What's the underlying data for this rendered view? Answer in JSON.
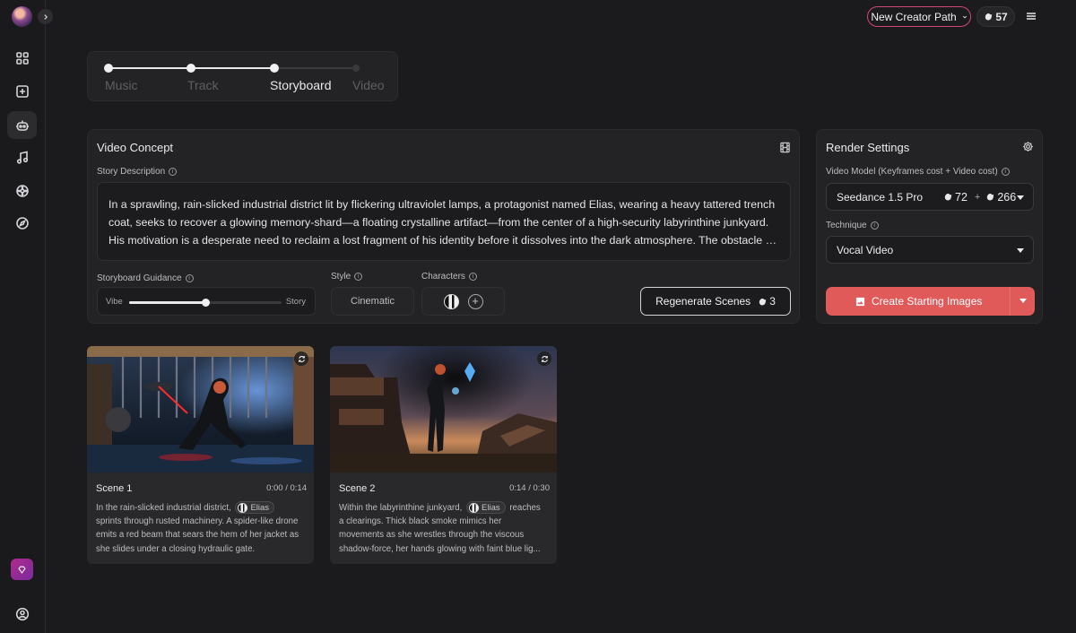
{
  "sidebar": {
    "items": [
      {
        "icon": "grid-icon"
      },
      {
        "icon": "add-square-icon"
      },
      {
        "icon": "robot-icon",
        "active": true
      },
      {
        "icon": "music-note-icon"
      },
      {
        "icon": "flower-icon"
      },
      {
        "icon": "compass-icon"
      }
    ],
    "bottom": [
      {
        "icon": "gem-icon"
      },
      {
        "icon": "user-circle-icon"
      }
    ]
  },
  "header": {
    "creator_path_label": "New Creator Path",
    "credits": "57"
  },
  "stepper": {
    "steps": [
      "Music",
      "Track",
      "Storyboard",
      "Video"
    ],
    "current": "Storyboard"
  },
  "video_concept": {
    "title": "Video Concept",
    "story_label": "Story Description",
    "story_lines": [
      "In a sprawling, rain-slicked industrial district lit by flickering ultraviolet lamps, a protagonist named Elias, wearing a heavy tattered trench",
      "coat, seeks to recover a glowing memory-shard—a floating crystalline artifact—from the center of a high-security labyrinthine junkyard.",
      "His motivation is a desperate need to reclaim a lost fragment of his identity before it dissolves into the dark atmosphere. The obstacle is..."
    ],
    "guidance_label": "Storyboard Guidance",
    "guidance_left": "Vibe",
    "guidance_right": "Story",
    "guidance_value": 0.5,
    "style_label": "Style",
    "style_value": "Cinematic",
    "characters_label": "Characters",
    "regenerate_label": "Regenerate Scenes",
    "regenerate_cost": "3"
  },
  "render_settings": {
    "title": "Render Settings",
    "model_label": "Video Model (Keyframes cost + Video cost)",
    "model_value": "Seedance 1.5 Pro",
    "keyframe_cost": "72",
    "plus": "+",
    "video_cost": "266",
    "technique_label": "Technique",
    "technique_value": "Vocal Video",
    "create_label": "Create Starting Images"
  },
  "scenes": [
    {
      "title": "Scene 1",
      "time": "0:00 / 0:14",
      "desc_pre": "In the rain-slicked industrial district,",
      "tag": "Elias",
      "desc_lines": [
        "sprints through rusted machinery. A spider-like drone",
        "emits a red beam that sears the hem of her jacket as",
        "she slides under a closing hydraulic gate."
      ]
    },
    {
      "title": "Scene 2",
      "time": "0:14 / 0:30",
      "desc_pre": "Within the labyrinthine junkyard,",
      "tag": "Elias",
      "desc_post": "reaches",
      "desc_lines": [
        "a clearings. Thick black smoke mimics her",
        "movements as she wrestles through the viscous",
        "shadow-force, her hands glowing with faint blue lig..."
      ]
    }
  ],
  "colors": {
    "accent_pink": "#d1457a",
    "create_button": "#e05a5a",
    "background": "#1b1b1d",
    "panel": "#232325"
  }
}
